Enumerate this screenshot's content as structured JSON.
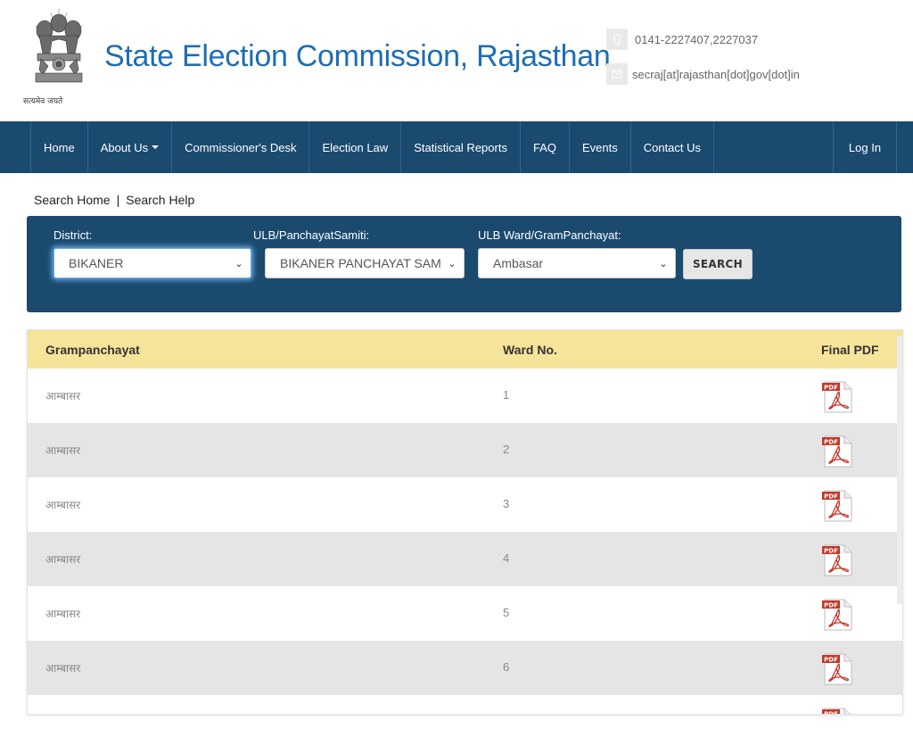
{
  "header": {
    "title": "State Election Commission, Rajasthan",
    "emblem_motto": "सत्यमेव जयते",
    "phone": "0141-2227407,2227037",
    "email": "secraj[at]rajasthan[dot]gov[dot]in",
    "phone_icon": "phone-icon",
    "email_icon": "envelope-icon"
  },
  "nav": {
    "items": [
      "Home",
      "About Us",
      "Commissioner's Desk",
      "Election Law",
      "Statistical Reports",
      "FAQ",
      "Events",
      "Contact Us"
    ],
    "login": "Log In"
  },
  "breadcrumb": {
    "home": "Search Home",
    "separator": "|",
    "help": "Search Help"
  },
  "search": {
    "district_label": "District:",
    "district_value": "BIKANER",
    "ulb_label": "ULB/PanchayatSamiti:",
    "ulb_value": "BIKANER PANCHAYAT SAM",
    "ward_label": "ULB Ward/GramPanchayat:",
    "ward_value": "Ambasar",
    "button": "SEARCH"
  },
  "table": {
    "headers": [
      "Grampanchayat",
      "Ward No.",
      "Final PDF"
    ],
    "rows": [
      {
        "grampanchayat": "आम्बासर",
        "ward": "1"
      },
      {
        "grampanchayat": "आम्बासर",
        "ward": "2"
      },
      {
        "grampanchayat": "आम्बासर",
        "ward": "3"
      },
      {
        "grampanchayat": "आम्बासर",
        "ward": "4"
      },
      {
        "grampanchayat": "आम्बासर",
        "ward": "5"
      },
      {
        "grampanchayat": "आम्बासर",
        "ward": "6"
      }
    ],
    "pdf_label": "PDF"
  },
  "colors": {
    "brand": "#1e6db3",
    "nav_bg": "#1b4a6f",
    "table_header": "#f5e49a",
    "row_alt": "#e5e5e5",
    "pdf_red": "#c0392b"
  }
}
